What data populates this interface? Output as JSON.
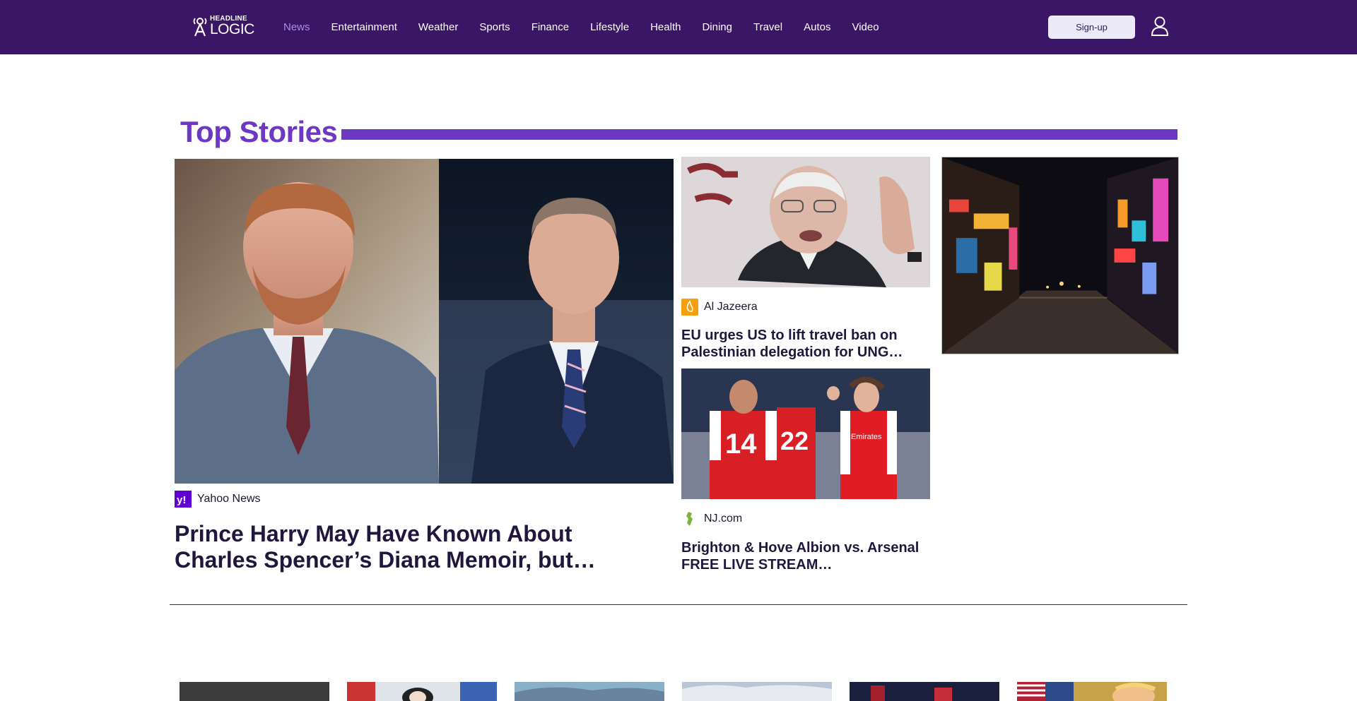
{
  "header": {
    "logo_top": "HEADLINE",
    "logo_bottom": "LOGIC",
    "nav": [
      {
        "label": "News",
        "active": true
      },
      {
        "label": "Entertainment"
      },
      {
        "label": "Weather"
      },
      {
        "label": "Sports"
      },
      {
        "label": "Finance"
      },
      {
        "label": "Lifestyle"
      },
      {
        "label": "Health"
      },
      {
        "label": "Dining"
      },
      {
        "label": "Travel"
      },
      {
        "label": "Autos"
      },
      {
        "label": "Video"
      }
    ],
    "signup_label": "Sign-up",
    "colors": {
      "bar": "#3b1667",
      "active_nav": "#a88fe4"
    }
  },
  "top_stories": {
    "title": "Top Stories",
    "accent": "#6d38c4",
    "main": {
      "source": "Yahoo News",
      "source_icon": "yahoo-logo-icon",
      "headline": "Prince Harry May Have Known About Charles Spencer’s Diana Memoir, but…"
    },
    "side": [
      {
        "source": "Al Jazeera",
        "source_icon": "al-jazeera-logo-icon",
        "headline": "EU urges US to lift travel ban on Palestinian delegation for UNG…"
      },
      {
        "source": "NJ.com",
        "source_icon": "nj-com-logo-icon",
        "headline": "Brighton & Hove Albion vs. Arsenal FREE LIVE STREAM…"
      }
    ],
    "main_image_text": "",
    "arsenal_numbers": [
      "14",
      "22"
    ],
    "arsenal_sponsor": "Emirates"
  }
}
